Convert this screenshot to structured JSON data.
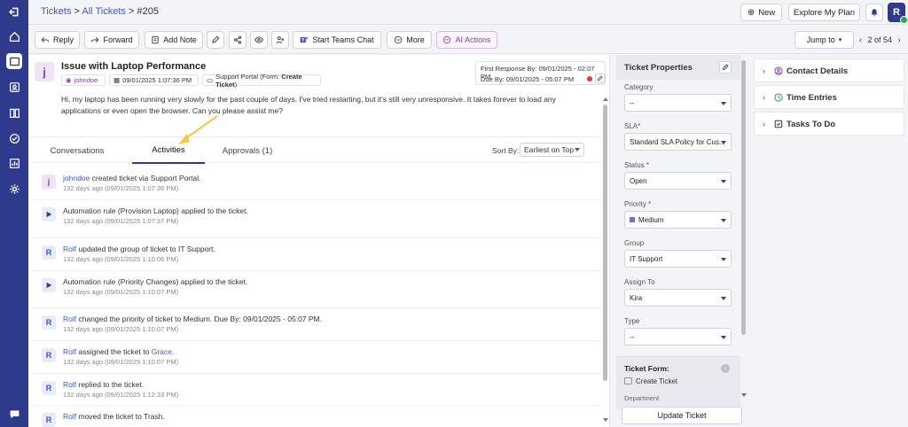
{
  "breadcrumb": {
    "tickets": "Tickets",
    "sep1": ">",
    "all": "All Tickets",
    "sep2": ">",
    "id": "#205"
  },
  "topbar": {
    "new_label": "New",
    "plan_label": "Explore My Plan",
    "avatar_letter": "R"
  },
  "actions": {
    "reply": "Reply",
    "forward": "Forward",
    "add_note": "Add Note",
    "teams": "Start Teams Chat",
    "more": "More",
    "ai": "AI Actions",
    "jump": "Jump to",
    "pager": "2 of 54"
  },
  "ticket": {
    "avatar": "j",
    "subject": "Issue with Laptop Performance",
    "requester": "johndoe",
    "created": "09/01/2025 1:07:36 PM",
    "source": "Support Portal (Form: ",
    "form_name": "Create Ticket",
    "source_close": ")",
    "first_response": "First Response By: 09/01/2025 - 02:07 PM",
    "due": "Due By: 09/01/2025 - 05:07 PM",
    "description": "Hi, my laptop has been running very slowly for the past couple of days. I've tried restarting, but it's still very unresponsive. It takes forever to load any applications or even open the browser. Can you please assist me?"
  },
  "tabs": {
    "conversations": "Conversations",
    "activities": "Activities",
    "approvals": "Approvals (1)"
  },
  "sort": {
    "label": "Sort By:",
    "value": "Earliest on Top"
  },
  "activities": [
    {
      "icon": "j",
      "user": "johndoe",
      "text": " created ticket via Support Portal.",
      "time": "132 days ago (09/01/2025 1:07:36 PM)"
    },
    {
      "icon": "play",
      "user": "",
      "text": "Automation rule (Provision Laptop) applied to the ticket.",
      "time": "132 days ago (09/01/2025 1:07:37 PM)"
    },
    {
      "icon": "R",
      "user": "Rolf",
      "text": " updated the group of ticket to IT Support.",
      "time": "132 days ago (09/01/2025 1:10:06 PM)"
    },
    {
      "icon": "play",
      "user": "",
      "text": "Automation rule (Priority Changes) applied to the ticket.",
      "time": "132 days ago (09/01/2025 1:10:07 PM)"
    },
    {
      "icon": "R",
      "user": "Rolf",
      "text": " changed the priority of ticket to Medium. Due By: 09/01/2025 - 05:07 PM.",
      "time": "132 days ago (09/01/2025 1:10:07 PM)"
    },
    {
      "icon": "R",
      "user": "Rolf",
      "text": " assigned the ticket to ",
      "link": "Grace",
      "tail": ".",
      "time": "132 days ago (09/01/2025 1:10:07 PM)"
    },
    {
      "icon": "R",
      "user": "Rolf",
      "text": " replied to the ticket.",
      "time": "132 days ago (09/01/2025 1:12:33 PM)"
    },
    {
      "icon": "R",
      "user": "Rolf",
      "text": " moved the ticket to Trash.",
      "time": ""
    }
  ],
  "properties": {
    "title": "Ticket Properties",
    "category_label": "Category",
    "category_value": "--",
    "sla_label": "SLA*",
    "sla_value": "Standard SLA Policy for Cus...",
    "status_label": "Status *",
    "status_value": "Open",
    "priority_label": "Priority *",
    "priority_value": "Medium",
    "priority_color": "#6a76c9",
    "group_label": "Group",
    "group_value": "IT Support",
    "assign_label": "Assign To",
    "assign_value": "Kira",
    "type_label": "Type",
    "type_value": "--",
    "form_title": "Ticket Form:",
    "form_value": "Create Ticket",
    "department_label": "Department",
    "update_button": "Update Ticket"
  },
  "right_panel": {
    "contact": "Contact Details",
    "time": "Time Entries",
    "tasks": "Tasks To Do"
  },
  "colors": {
    "nav": "#2e3a8c",
    "link": "#3b57c4",
    "ai": "#8a3ea8",
    "annotation_arrow": "#f2c94c"
  }
}
